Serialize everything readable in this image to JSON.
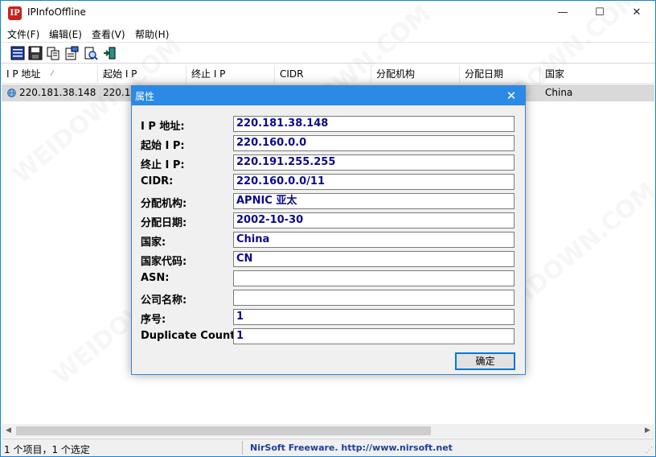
{
  "window": {
    "title": "IPInfoOffline",
    "app_icon_text": "IP",
    "controls": {
      "minimize": "—",
      "maximize": "☐",
      "close": "✕"
    }
  },
  "menu": [
    "文件(F)",
    "编辑(E)",
    "查看(V)",
    "帮助(H)"
  ],
  "toolbar": {
    "buttons": [
      "properties-icon",
      "save-icon",
      "copy-icon",
      "html-report-icon",
      "find-icon",
      "exit-icon"
    ]
  },
  "list": {
    "columns": [
      "I P 地址",
      "起始 I P",
      "终止 I P",
      "CIDR",
      "分配机构",
      "分配日期",
      "国家"
    ],
    "sort_indicator": "⁄",
    "rows": [
      {
        "ip": "220.181.38.148",
        "start_ip": "220.16",
        "country": "China"
      }
    ]
  },
  "status": {
    "items": "1 个项目，1 个选定",
    "link": "NirSoft Freeware.  http://www.nirsoft.net"
  },
  "dialog": {
    "title": "属性",
    "close": "✕",
    "fields": [
      {
        "label": "I P 地址:",
        "value": "220.181.38.148"
      },
      {
        "label": "起始 I P:",
        "value": "220.160.0.0"
      },
      {
        "label": "终止 I P:",
        "value": "220.191.255.255"
      },
      {
        "label": "CIDR:",
        "value": "220.160.0.0/11"
      },
      {
        "label": "分配机构:",
        "value": "APNIC 亚太"
      },
      {
        "label": "分配日期:",
        "value": "2002-10-30"
      },
      {
        "label": "国家:",
        "value": "China"
      },
      {
        "label": "国家代码:",
        "value": "CN"
      },
      {
        "label": "ASN:",
        "value": ""
      },
      {
        "label": "公司名称:",
        "value": ""
      },
      {
        "label": "序号:",
        "value": "1"
      },
      {
        "label": "Duplicate Count:",
        "value": "1"
      }
    ],
    "ok_label": "确定"
  },
  "watermark": "WEIDOWN.COM"
}
